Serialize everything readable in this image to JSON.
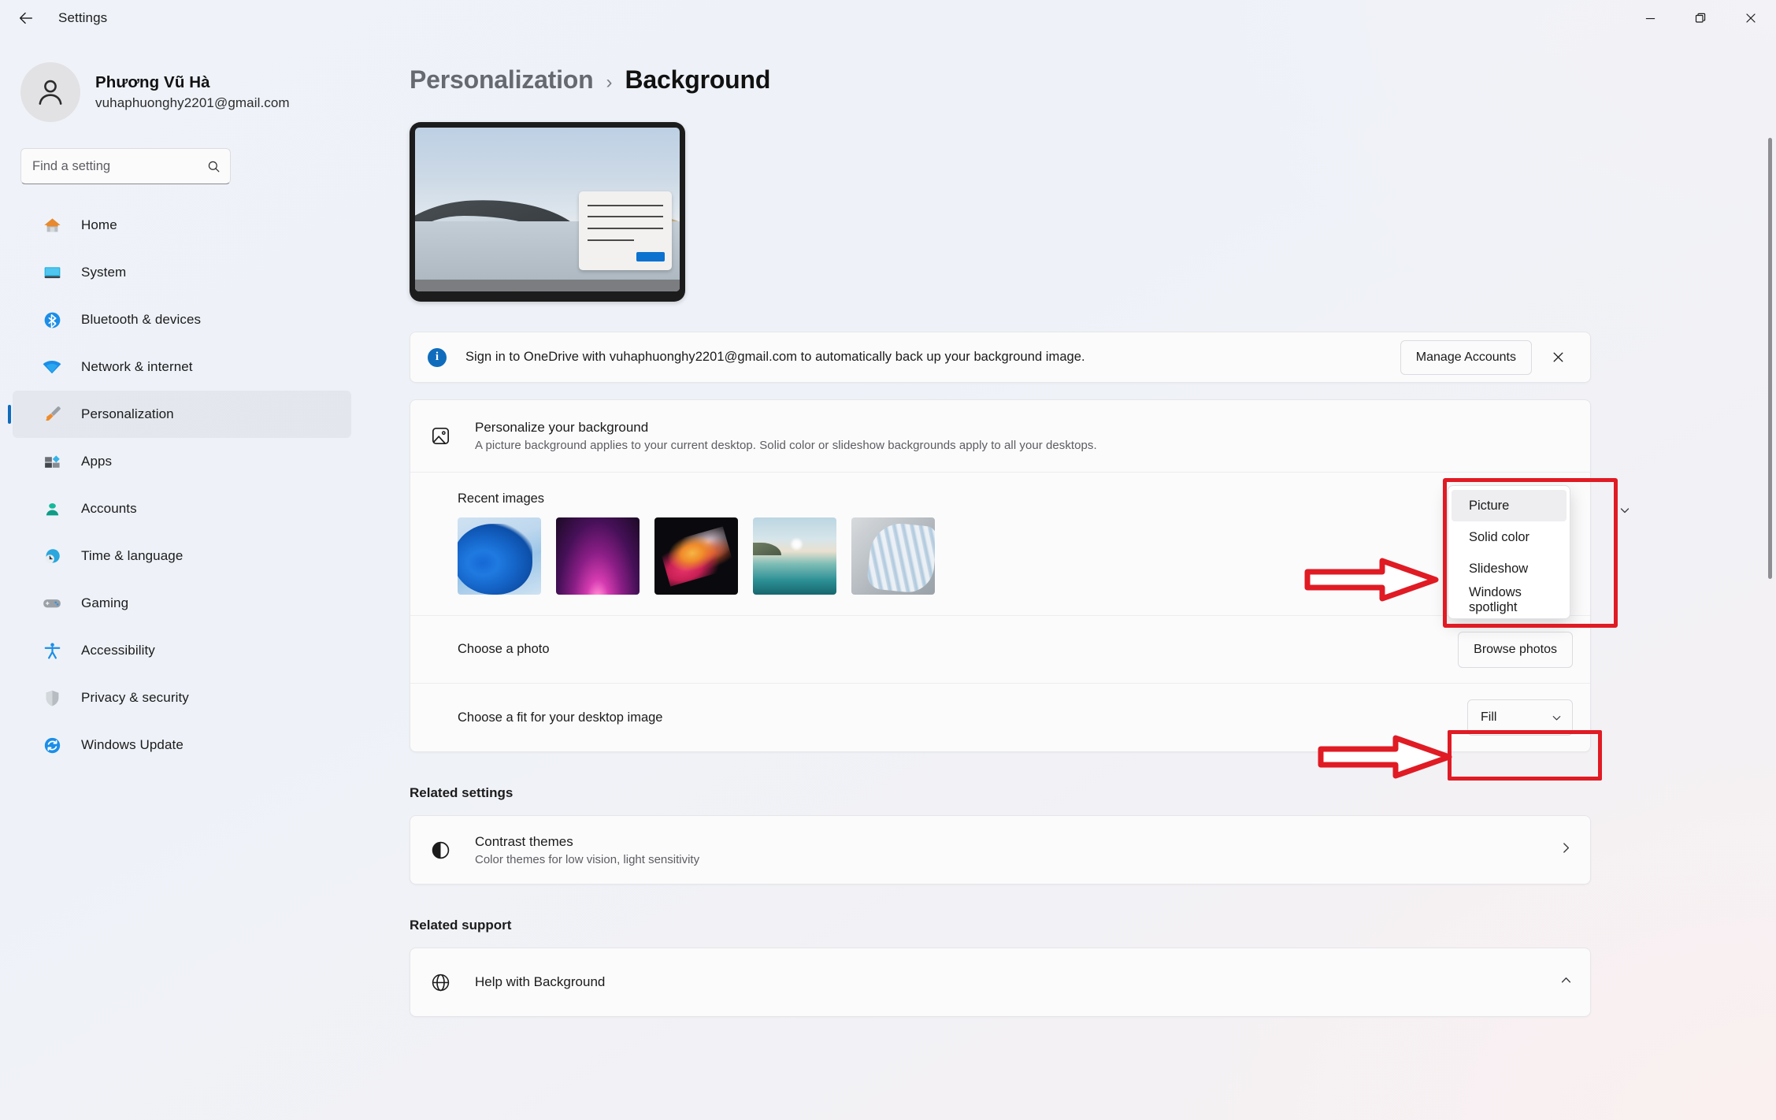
{
  "window": {
    "title": "Settings",
    "back_icon": "back-arrow-icon",
    "minimize_label": "Minimize",
    "maximize_label": "Restore",
    "close_label": "Close"
  },
  "account": {
    "name": "Phương Vũ Hà",
    "email": "vuhaphuonghy2201@gmail.com",
    "avatar_icon": "person-avatar-icon"
  },
  "search": {
    "placeholder": "Find a setting",
    "value": "",
    "icon": "search-icon"
  },
  "sidebar": {
    "items": [
      {
        "label": "Home",
        "icon": "home-icon",
        "active": false
      },
      {
        "label": "System",
        "icon": "monitor-icon",
        "active": false
      },
      {
        "label": "Bluetooth & devices",
        "icon": "bluetooth-icon",
        "active": false
      },
      {
        "label": "Network & internet",
        "icon": "wifi-icon",
        "active": false
      },
      {
        "label": "Personalization",
        "icon": "paintbrush-icon",
        "active": true
      },
      {
        "label": "Apps",
        "icon": "apps-icon",
        "active": false
      },
      {
        "label": "Accounts",
        "icon": "accounts-icon",
        "active": false
      },
      {
        "label": "Time & language",
        "icon": "clock-globe-icon",
        "active": false
      },
      {
        "label": "Gaming",
        "icon": "gamepad-icon",
        "active": false
      },
      {
        "label": "Accessibility",
        "icon": "accessibility-icon",
        "active": false
      },
      {
        "label": "Privacy & security",
        "icon": "shield-icon",
        "active": false
      },
      {
        "label": "Windows Update",
        "icon": "update-icon",
        "active": false
      }
    ]
  },
  "breadcrumb": {
    "parent": "Personalization",
    "separator": "›",
    "current": "Background"
  },
  "banner": {
    "icon": "info-icon",
    "text": "Sign in to OneDrive with vuhaphuonghy2201@gmail.com to automatically back up your background image.",
    "button_label": "Manage Accounts",
    "close_icon": "close-icon"
  },
  "background_section": {
    "icon": "picture-icon",
    "title": "Personalize your background",
    "description": "A picture background applies to your current desktop. Solid color or slideshow backgrounds apply to all your desktops.",
    "selected_option": "Picture",
    "chevron_icon": "chevron-down-icon",
    "options": [
      {
        "label": "Picture",
        "selected": true
      },
      {
        "label": "Solid color",
        "selected": false
      },
      {
        "label": "Slideshow",
        "selected": false
      },
      {
        "label": "Windows spotlight",
        "selected": false
      }
    ],
    "recent_images_label": "Recent images",
    "recent_images": [
      {
        "name": "windows-11-bloom-blue"
      },
      {
        "name": "purple-glow-abstract"
      },
      {
        "name": "colorful-ribbon-abstract"
      },
      {
        "name": "sunrise-lake-landscape"
      },
      {
        "name": "white-paper-folds"
      }
    ],
    "choose_photo_label": "Choose a photo",
    "browse_button_label": "Browse photos",
    "fit_label": "Choose a fit for your desktop image",
    "fit_value": "Fill"
  },
  "related_settings": {
    "title": "Related settings",
    "items": [
      {
        "icon": "contrast-icon",
        "title": "Contrast themes",
        "description": "Color themes for low vision, light sensitivity",
        "chevron": "chevron-right-icon"
      }
    ]
  },
  "related_support": {
    "title": "Related support",
    "items": [
      {
        "icon": "globe-help-icon",
        "title": "Help with Background",
        "chevron": "chevron-up-icon"
      }
    ]
  },
  "annotations": {
    "accent_red": "#e01b24",
    "accent_blue": "#0f6cbd",
    "arrow_dropdown": "red-arrow-to-dropdown",
    "arrow_browse": "red-arrow-to-browse-photos",
    "box_dropdown": "red-box-around-dropdown",
    "box_browse": "red-box-around-browse-photos"
  }
}
